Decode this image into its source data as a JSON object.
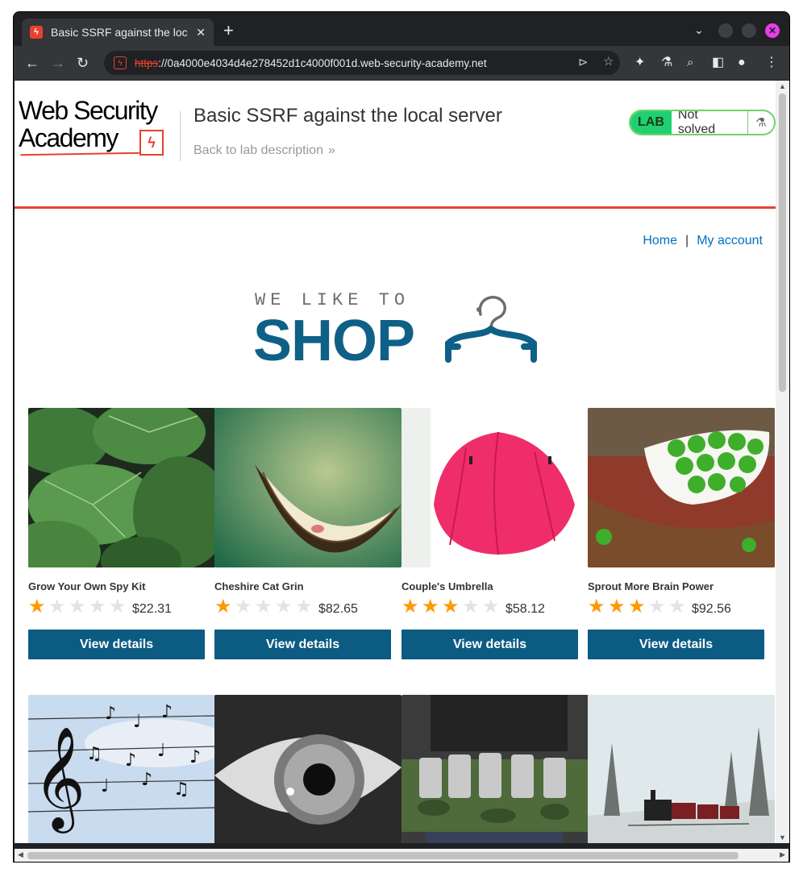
{
  "browser": {
    "tab_title": "Basic SSRF against the loc",
    "tab_favicon": "lightning-icon",
    "url_scheme": "https",
    "url_rest": "://0a4000e4034d4e278452d1c4000f001d.web-security-academy.net"
  },
  "lab": {
    "logo_line1": "Web Security",
    "logo_line2": "Academy",
    "title": "Basic SSRF against the local server",
    "back_link": "Back to lab description",
    "badge": "LAB",
    "status": "Not solved"
  },
  "nav": {
    "home": "Home",
    "separator": "|",
    "account": "My account"
  },
  "banner": {
    "top": "WE LIKE TO",
    "main": "SHOP"
  },
  "products": [
    {
      "name": "Grow Your Own Spy Kit",
      "rating": 1,
      "price": "$22.31",
      "button": "View details",
      "image": "leaves"
    },
    {
      "name": "Cheshire Cat Grin",
      "rating": 1,
      "price": "$82.65",
      "button": "View details",
      "image": "grin"
    },
    {
      "name": "Couple's Umbrella",
      "rating": 3,
      "price": "$58.12",
      "button": "View details",
      "image": "umbrella"
    },
    {
      "name": "Sprout More Brain Power",
      "rating": 3,
      "price": "$92.56",
      "button": "View details",
      "image": "sprouts"
    }
  ],
  "products_row2": [
    {
      "image": "music-notes"
    },
    {
      "image": "eye"
    },
    {
      "image": "beer-belt"
    },
    {
      "image": "train"
    }
  ],
  "colors": {
    "accent": "#e9412d",
    "button": "#0c5b83",
    "star": "#ff9900",
    "link": "#0071bc"
  }
}
